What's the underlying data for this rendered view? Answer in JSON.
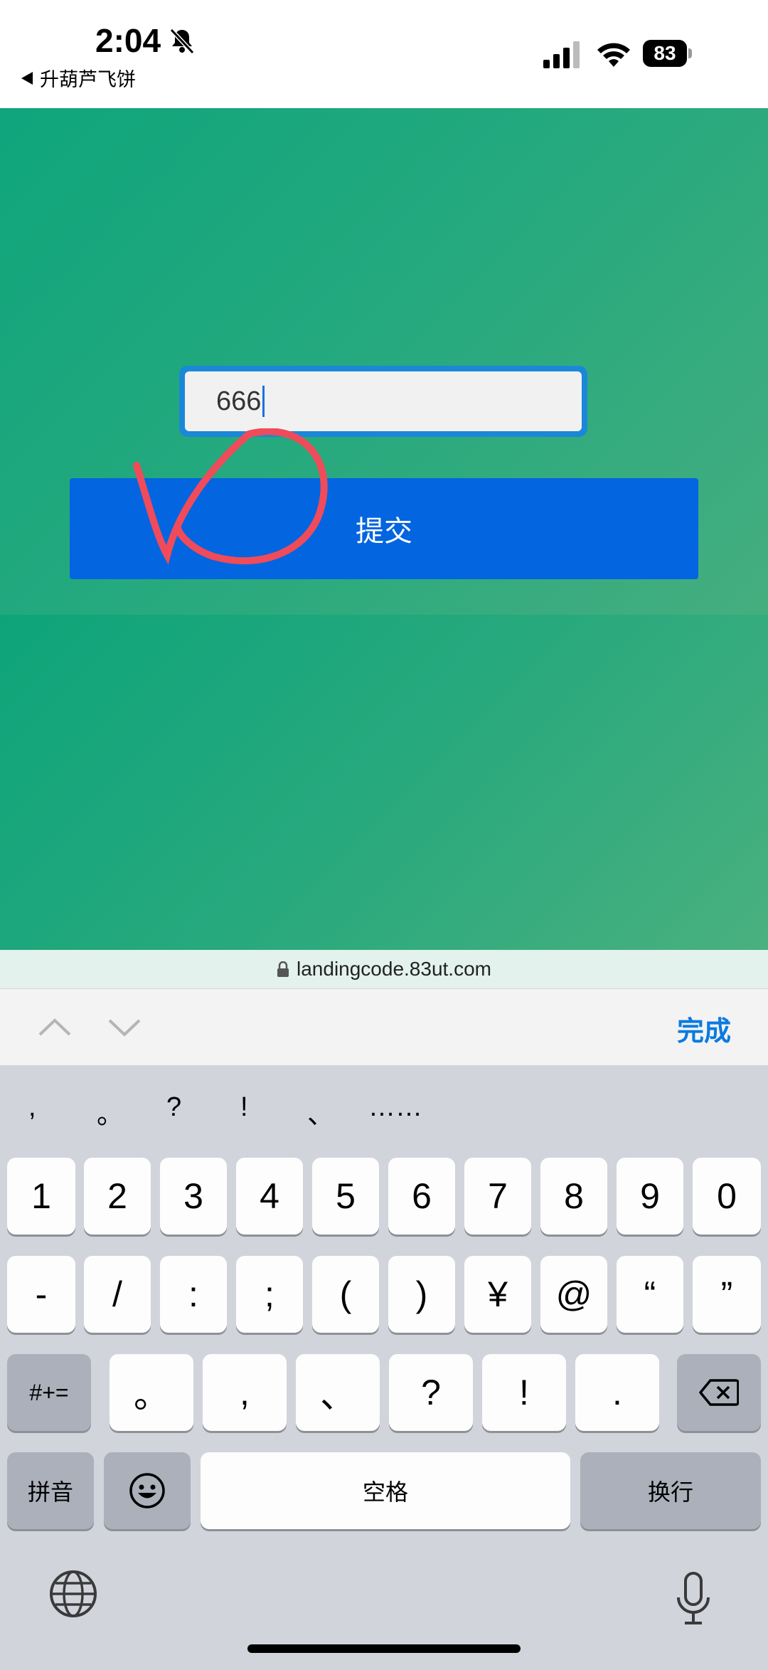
{
  "status": {
    "time": "2:04",
    "back_app": "升葫芦飞饼",
    "battery": "83"
  },
  "form": {
    "code_value": "666",
    "submit_label": "提交"
  },
  "url_bar": {
    "domain": "landingcode.83ut.com"
  },
  "accessory": {
    "done_label": "完成"
  },
  "keyboard": {
    "candidates": [
      ",",
      "。",
      "?",
      "!",
      "、",
      "……"
    ],
    "row1": [
      "1",
      "2",
      "3",
      "4",
      "5",
      "6",
      "7",
      "8",
      "9",
      "0"
    ],
    "row2": [
      "-",
      "/",
      ":",
      ";",
      "(",
      ")",
      "¥",
      "@",
      "“",
      "”"
    ],
    "row3_left": "#+=",
    "row3": [
      "。",
      ",",
      "、",
      "?",
      "!",
      "."
    ],
    "pinyin_label": "拼音",
    "space_label": "空格",
    "return_label": "换行"
  },
  "colors": {
    "green_bg": "#1ea77d",
    "input_border": "#1b87d8",
    "submit_bg": "#0365e0",
    "annotation": "#f04b5a",
    "accent_blue": "#0a7ae0"
  }
}
